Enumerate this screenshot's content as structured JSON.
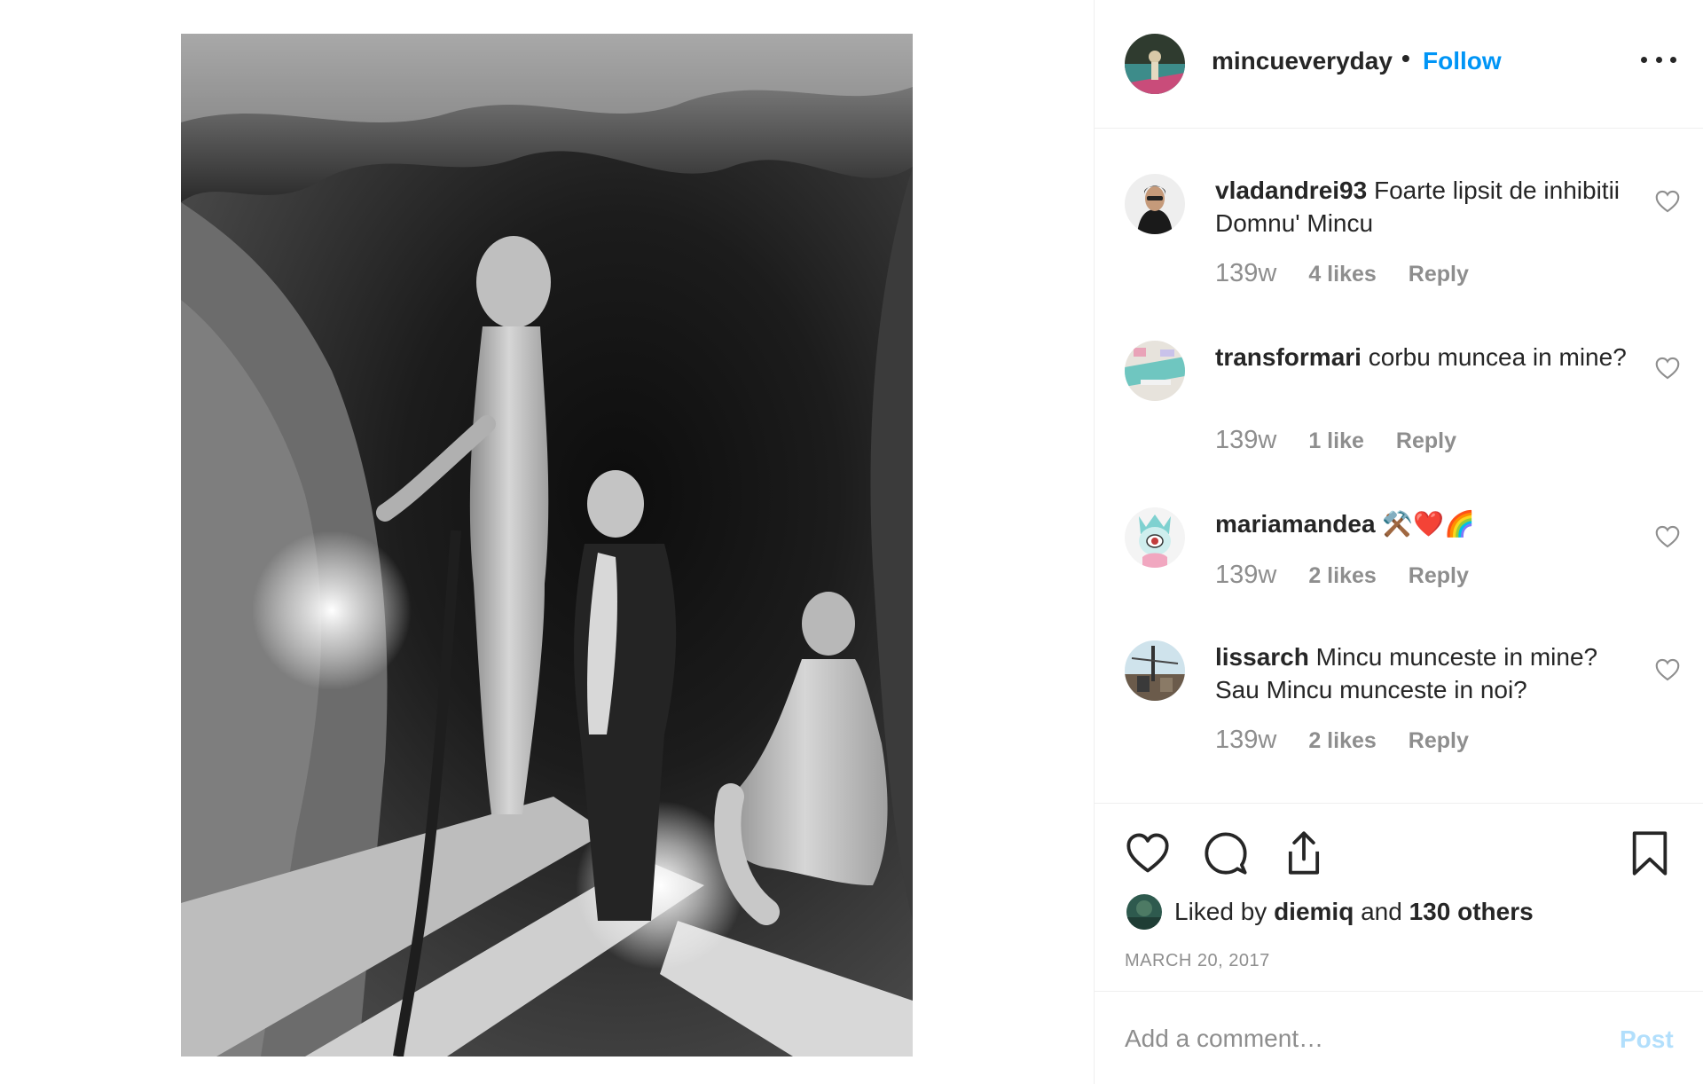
{
  "post": {
    "photo_alt": "Black and white photo of three people inside a mine tunnel",
    "author": {
      "username": "mincueveryday",
      "separator": "•",
      "follow_label": "Follow"
    },
    "comments": [
      {
        "username": "vladandrei93",
        "text": "Foarte lipsit de inhibitii Domnu' Mincu",
        "time": "139w",
        "likes": "4 likes",
        "reply": "Reply"
      },
      {
        "username": "transformari",
        "text": "corbu muncea in mine?",
        "time": "139w",
        "likes": "1 like",
        "reply": "Reply"
      },
      {
        "username": "mariamandea",
        "text": "⚒️❤️🌈",
        "time": "139w",
        "likes": "2 likes",
        "reply": "Reply"
      },
      {
        "username": "lissarch",
        "text": "Mincu munceste in mine? Sau Mincu munceste in noi?",
        "time": "139w",
        "likes": "2 likes",
        "reply": "Reply"
      }
    ],
    "liked_by": {
      "prefix": "Liked by",
      "user": "diemiq",
      "middle": "and",
      "others": "130 others"
    },
    "date": "MARCH 20, 2017",
    "add_comment": {
      "placeholder": "Add a comment…",
      "post_label": "Post"
    },
    "icons": [
      "more-options-icon",
      "heart-icon",
      "comment-icon",
      "share-icon",
      "bookmark-icon"
    ],
    "colors": {
      "link": "#0095f6",
      "muted": "#8e8e8e",
      "text": "#262626",
      "post_disabled": "#b2dffc"
    }
  }
}
